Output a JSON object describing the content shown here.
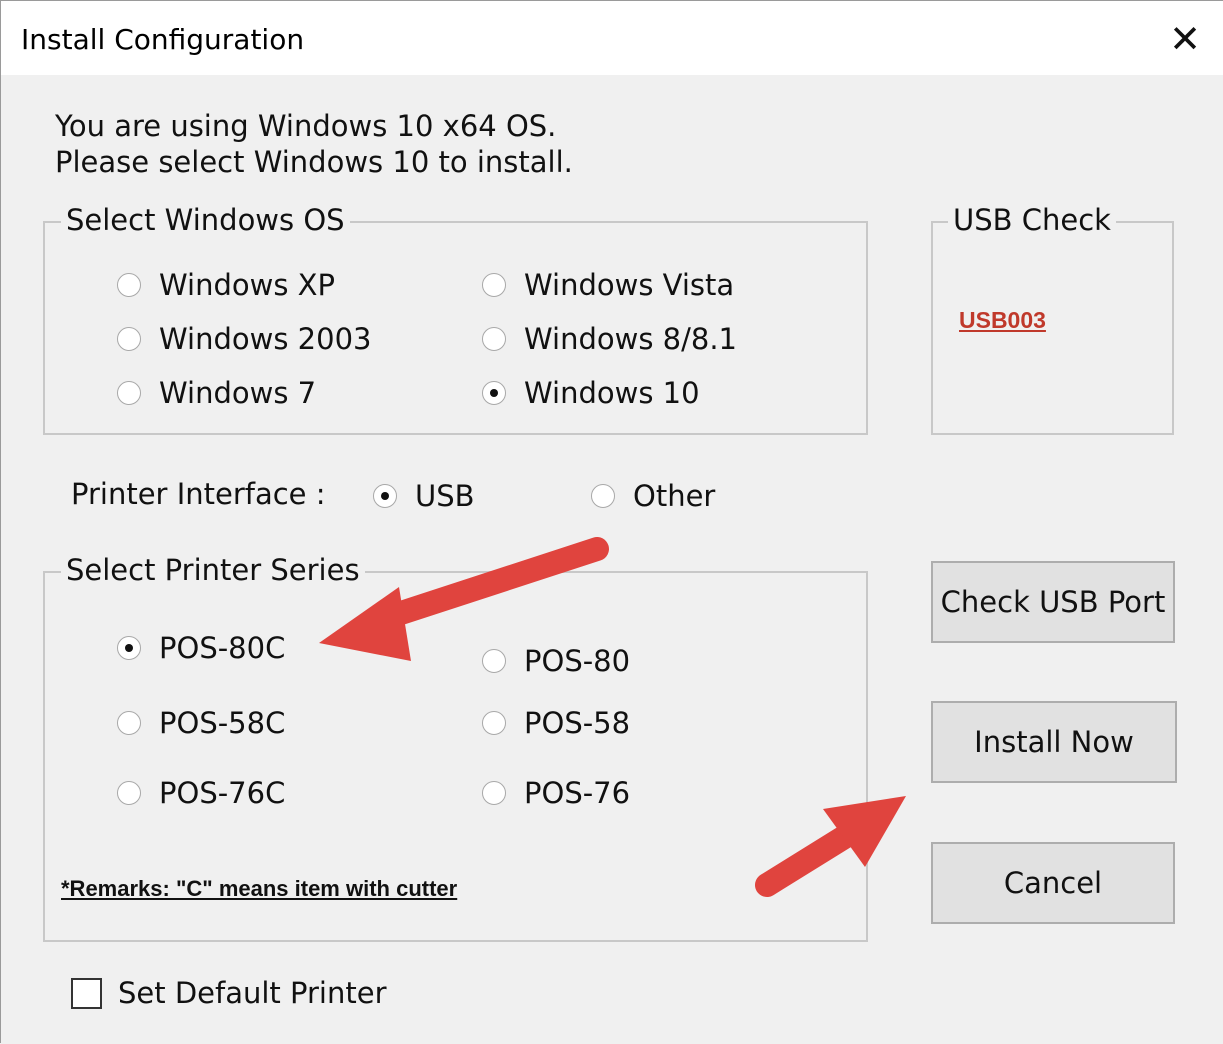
{
  "window": {
    "title": "Install Configuration",
    "close_glyph": "✕"
  },
  "info": {
    "line1": "You are using Windows 10 x64 OS.",
    "line2": "Please select Windows 10 to install."
  },
  "os_group": {
    "legend": "Select Windows OS",
    "options": [
      {
        "label": "Windows XP",
        "selected": false
      },
      {
        "label": "Windows Vista",
        "selected": false
      },
      {
        "label": "Windows 2003",
        "selected": false
      },
      {
        "label": "Windows 8/8.1",
        "selected": false
      },
      {
        "label": "Windows 7",
        "selected": false
      },
      {
        "label": "Windows 10",
        "selected": true
      }
    ]
  },
  "usb_check": {
    "legend": "USB Check",
    "port": "USB003"
  },
  "interface": {
    "label": "Printer Interface :",
    "options": [
      {
        "label": "USB",
        "selected": true
      },
      {
        "label": "Other",
        "selected": false
      }
    ]
  },
  "series_group": {
    "legend": "Select Printer Series",
    "options": [
      {
        "label": "POS-80C",
        "selected": true
      },
      {
        "label": "POS-80",
        "selected": false
      },
      {
        "label": "POS-58C",
        "selected": false
      },
      {
        "label": "POS-58",
        "selected": false
      },
      {
        "label": "POS-76C",
        "selected": false
      },
      {
        "label": "POS-76",
        "selected": false
      }
    ],
    "remarks": "*Remarks: \"C\" means item with cutter"
  },
  "buttons": {
    "check_usb": "Check USB Port",
    "install": "Install Now",
    "cancel": "Cancel"
  },
  "default_printer": {
    "label": "Set Default Printer",
    "checked": false
  },
  "colors": {
    "annotation_arrow": "#e0443e",
    "link": "#c0392b"
  }
}
